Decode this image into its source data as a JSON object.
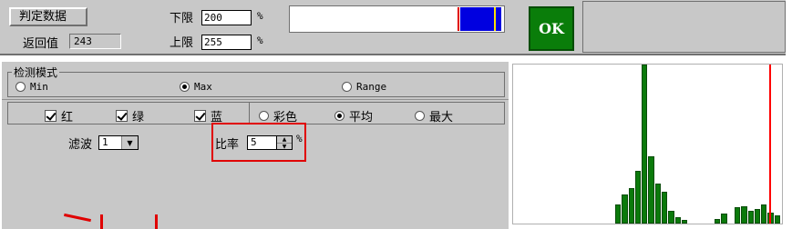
{
  "top": {
    "judge_label": "判定数据",
    "return_label": "返回值",
    "return_value": "243",
    "lower_label": "下限",
    "lower_value": "200",
    "lower_unit": "%",
    "upper_label": "上限",
    "upper_value": "255",
    "upper_unit": "%",
    "ok_label": "OK",
    "ok_color": "#0a7d0a",
    "swatch_color": "#0000e0"
  },
  "detect": {
    "legend": "检测模式",
    "modes": [
      {
        "label": "Min",
        "selected": false
      },
      {
        "label": "Max",
        "selected": true
      },
      {
        "label": "Range",
        "selected": false
      }
    ]
  },
  "channels": [
    {
      "label": "红",
      "checked": true
    },
    {
      "label": "绿",
      "checked": true
    },
    {
      "label": "蓝",
      "checked": true
    }
  ],
  "calc": [
    {
      "label": "彩色",
      "selected": false
    },
    {
      "label": "平均",
      "selected": true
    },
    {
      "label": "最大",
      "selected": false
    }
  ],
  "filter": {
    "label": "滤波",
    "value": "1"
  },
  "ratio": {
    "label": "比率",
    "value": "5",
    "unit": "%"
  },
  "histogram": {
    "bar_color": "#0b7a0b",
    "marker_color": "#ff0000",
    "levels": [
      0.12,
      0.18,
      0.22,
      0.33,
      1.0,
      0.42,
      0.25,
      0.2,
      0.08,
      0.04,
      0.02,
      0,
      0,
      0,
      0,
      0.03,
      0.06,
      0,
      0.1,
      0.11,
      0.08,
      0.09,
      0.12,
      0.07,
      0.05
    ]
  }
}
